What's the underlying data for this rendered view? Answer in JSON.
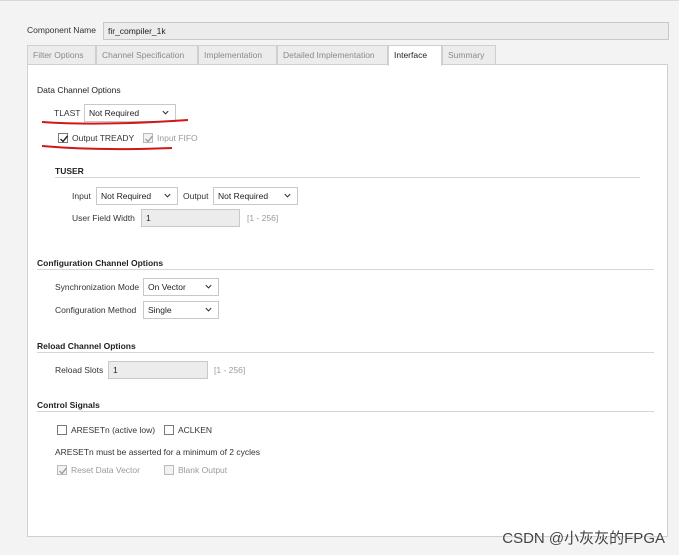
{
  "component": {
    "label": "Component Name",
    "value": "fir_compiler_1k"
  },
  "tabs": [
    {
      "label": "Filter Options"
    },
    {
      "label": "Channel Specification"
    },
    {
      "label": "Implementation"
    },
    {
      "label": "Detailed Implementation"
    },
    {
      "label": "Interface"
    },
    {
      "label": "Summary"
    }
  ],
  "active_tab": "Interface",
  "data_channel": {
    "heading": "Data Channel Options",
    "tlast_label": "TLAST",
    "tlast_value": "Not Required",
    "output_tready_label": "Output TREADY",
    "output_tready_checked": true,
    "input_fifo_label": "Input FIFO",
    "input_fifo_checked": true
  },
  "tuser": {
    "heading": "TUSER",
    "input_label": "Input",
    "input_value": "Not Required",
    "output_label": "Output",
    "output_value": "Not Required",
    "width_label": "User Field Width",
    "width_value": "1",
    "width_range": "[1 - 256]"
  },
  "config_channel": {
    "heading": "Configuration Channel Options",
    "sync_label": "Synchronization Mode",
    "sync_value": "On Vector",
    "method_label": "Configuration Method",
    "method_value": "Single"
  },
  "reload_channel": {
    "heading": "Reload Channel Options",
    "slots_label": "Reload Slots",
    "slots_value": "1",
    "slots_range": "[1 - 256]"
  },
  "control_signals": {
    "heading": "Control Signals",
    "aresetn_label": "ARESETn (active low)",
    "aclken_label": "ACLKEN",
    "note": "ARESETn must be asserted for a minimum of 2 cycles",
    "reset_data_label": "Reset Data Vector",
    "blank_output_label": "Blank Output"
  },
  "watermark": "CSDN @小灰灰的FPGA",
  "colors": {
    "annotation_red": "#d01818",
    "panel_bg": "#ffffff",
    "chrome_bg": "#f3f3f3"
  }
}
